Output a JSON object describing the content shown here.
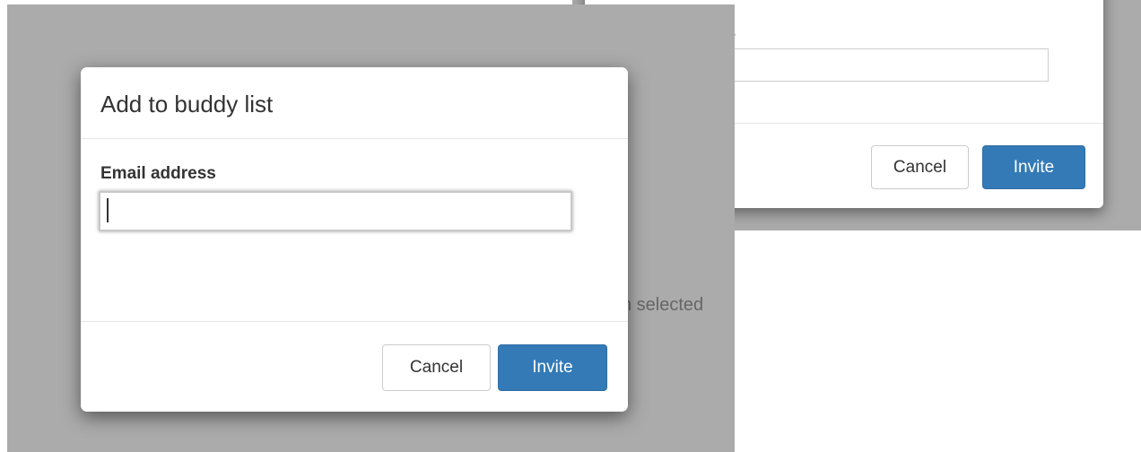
{
  "background_dialog": {
    "label_fragment": "ss",
    "email_value": "",
    "cancel_label": "Cancel",
    "invite_label": "Invite"
  },
  "background_page": {
    "text_fragment": "n selected"
  },
  "dialog": {
    "title": "Add to buddy list",
    "field_label": "Email address",
    "email_value": "",
    "cancel_label": "Cancel",
    "invite_label": "Invite"
  },
  "colors": {
    "overlay": "#ababab",
    "primary": "#337ab7",
    "text": "#333333"
  }
}
